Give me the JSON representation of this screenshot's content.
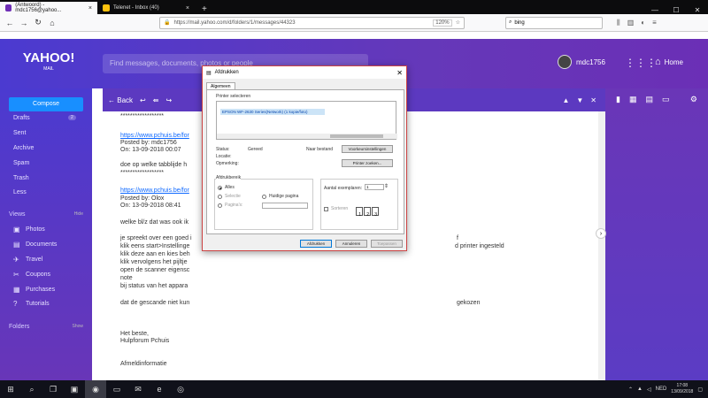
{
  "browser": {
    "tabs": [
      {
        "title": "(Antwoord) - mdc1756@yahoo...",
        "active": true,
        "favicon_color": "#6f2fb6"
      },
      {
        "title": "Telenet - Inbox (40)",
        "active": false,
        "favicon_color": "#ffc20e"
      }
    ],
    "new_tab": "+",
    "url": "https://mail.yahoo.com/d/folders/1/messages/44323",
    "zoom": "120%",
    "search_value": "bing"
  },
  "yahoo": {
    "logo": "YAHOO!",
    "logo_sub": "MAIL",
    "search_placeholder": "Find messages, documents, photos or people",
    "username": "mdc1756",
    "home_label": "Home"
  },
  "sidebar": {
    "compose": "Compose",
    "folders": [
      {
        "label": "Drafts",
        "count": "2"
      },
      {
        "label": "Sent",
        "count": ""
      },
      {
        "label": "Archive",
        "count": ""
      },
      {
        "label": "Spam",
        "count": ""
      },
      {
        "label": "Trash",
        "count": ""
      },
      {
        "label": "Less",
        "count": ""
      }
    ],
    "views_heading": "Views",
    "views_hide": "Hide",
    "views": [
      {
        "label": "Photos",
        "icon": "image-icon"
      },
      {
        "label": "Documents",
        "icon": "document-icon"
      },
      {
        "label": "Travel",
        "icon": "plane-icon"
      },
      {
        "label": "Coupons",
        "icon": "scissors-icon"
      },
      {
        "label": "Purchases",
        "icon": "cart-icon"
      },
      {
        "label": "Tutorials",
        "icon": "help-icon"
      }
    ],
    "folders_heading": "Folders",
    "folders_show": "Show"
  },
  "toolbar": {
    "back": "Back"
  },
  "message": {
    "lines": [
      {
        "text": "******************",
        "link": false
      },
      {
        "text": "https://www.pchuis.be/for",
        "link": true
      },
      {
        "text": "Posted by: mdc1756",
        "link": false
      },
      {
        "text": "On: 13-09-2018 00:07",
        "link": false
      },
      {
        "text": "doe op welke tabblijde h",
        "link": false
      },
      {
        "text": "******************",
        "link": false
      },
      {
        "text": "https://www.pchuis.be/for",
        "link": true
      },
      {
        "text": "Posted by: Olox",
        "link": false
      },
      {
        "text": "On: 13-09-2018 08:41",
        "link": false
      },
      {
        "text": "welke bl/z dat was ook ik",
        "link": false
      },
      {
        "text": "je spreekt over een goed i",
        "link": false
      },
      {
        "text": "klik eens start>Instellinge",
        "link": false
      },
      {
        "text": "klik deze aan en kies beh",
        "link": false
      },
      {
        "text": "klik vervolgens het pijltje",
        "link": false
      },
      {
        "text": "open de scanner eigensc",
        "link": false
      },
      {
        "text": "note",
        "link": false
      },
      {
        "text": "bij status van het appara",
        "link": false
      },
      {
        "text": "dat de gescande niet kun",
        "link": false
      },
      {
        "text": "Het beste,",
        "link": false
      },
      {
        "text": "Hulpforum Pchuis",
        "link": false
      },
      {
        "text": "Afmeldinformatie",
        "link": false
      }
    ],
    "right_fragments": [
      "f",
      "d printer ingesteld",
      "gekozen"
    ]
  },
  "dialog": {
    "title": "Afdrukken",
    "tab": "Algemeen",
    "printer_select_label": "Printer selecteren",
    "selected_printer": "EPSON WF-2630 Series(Network) (1 kopie/foto)",
    "status_label": "Status:",
    "status_value": "Gereed",
    "location_label": "Locatie:",
    "comment_label": "Opmerking:",
    "print_to_file_label": "Naar bestand",
    "preferences_button": "Voorkeursinstellingen",
    "find_printer_button": "Printer zoeken...",
    "page_range_label": "Afdrukbereik",
    "all_label": "Alles",
    "selection_label": "Selectie",
    "current_page_label": "Huidige pagina",
    "pages_label": "Pagina's:",
    "copies_label": "Aantal exemplaren:",
    "copies_value": "1",
    "collate_label": "Sorteren",
    "print_button": "Afdrukken",
    "cancel_button": "Annuleren",
    "apply_button": "Toepassen"
  },
  "taskbar": {
    "language": "NED",
    "time": "17:08",
    "date": "13/09/2018"
  }
}
